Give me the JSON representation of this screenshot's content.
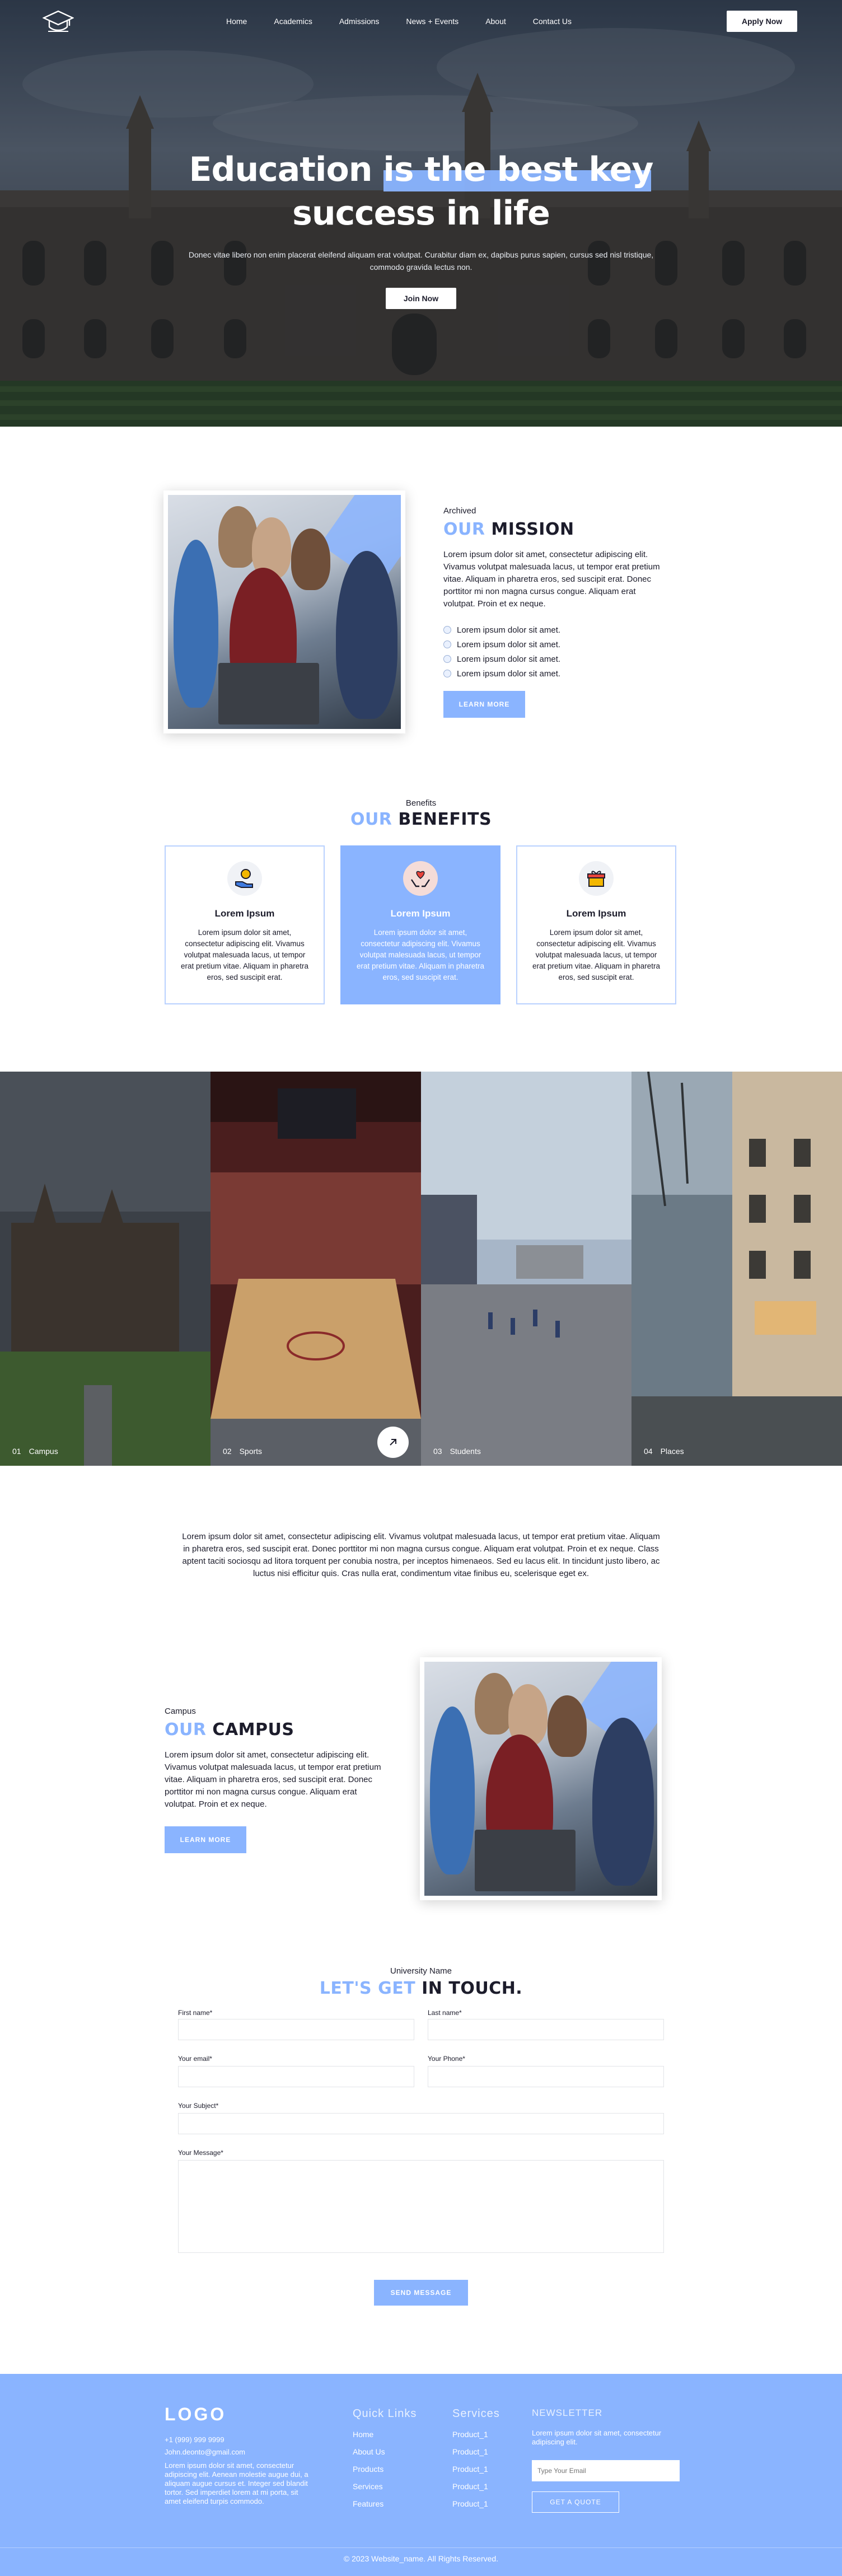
{
  "colors": {
    "accent": "#8ab4ff",
    "text": "#1c1c2b",
    "white": "#ffffff"
  },
  "nav": {
    "logo_icon": "graduation-cap-icon",
    "links": [
      "Home",
      "Academics",
      "Admissions",
      "News + Events",
      "About",
      "Contact Us"
    ],
    "apply_label": "Apply Now"
  },
  "hero": {
    "title_line1": "Education is the best key",
    "title_line2": "success in life",
    "subtitle": "Donec vitae libero non enim placerat eleifend aliquam erat volutpat. Curabitur diam ex, dapibus purus sapien, cursus sed nisl tristique, commodo gravida lectus non.",
    "cta_label": "Join Now"
  },
  "mission": {
    "eyebrow": "Archived",
    "title_accent": "OUR",
    "title_rest": "MISSION",
    "text": "Lorem ipsum dolor sit amet, consectetur adipiscing elit. Vivamus volutpat malesuada lacus, ut tempor erat pretium vitae. Aliquam in pharetra eros, sed suscipit erat. Donec porttitor mi non magna cursus congue. Aliquam erat volutpat. Proin et ex neque.",
    "checklist": [
      "Lorem ipsum dolor sit amet.",
      "Lorem ipsum dolor sit amet.",
      "Lorem ipsum dolor sit amet.",
      "Lorem ipsum dolor sit amet."
    ],
    "button_label": "LEARN MORE"
  },
  "benefits": {
    "eyebrow": "Benefits",
    "title_accent": "OUR",
    "title_rest": "BENEFITS",
    "cards": [
      {
        "icon": "hand-coin-icon",
        "title": "Lorem Ipsum",
        "text": "Lorem ipsum dolor sit amet, consectetur adipiscing elit. Vivamus volutpat malesuada lacus, ut tempor erat pretium vitae. Aliquam in pharetra eros, sed suscipit erat."
      },
      {
        "icon": "heart-hands-icon",
        "title": "Lorem Ipsum",
        "text": "Lorem ipsum dolor sit amet, consectetur adipiscing elit. Vivamus volutpat malesuada lacus, ut tempor erat pretium vitae. Aliquam in pharetra eros, sed suscipit erat."
      },
      {
        "icon": "gift-box-icon",
        "title": "Lorem Ipsum",
        "text": "Lorem ipsum dolor sit amet, consectetur adipiscing elit. Vivamus volutpat malesuada lacus, ut tempor erat pretium vitae. Aliquam in pharetra eros, sed suscipit erat."
      }
    ]
  },
  "gallery": [
    {
      "num": "01",
      "label": "Campus"
    },
    {
      "num": "02",
      "label": "Sports"
    },
    {
      "num": "03",
      "label": "Students"
    },
    {
      "num": "04",
      "label": "Places"
    }
  ],
  "intro_paragraph": "Lorem ipsum dolor sit amet, consectetur adipiscing elit. Vivamus volutpat malesuada lacus, ut tempor erat pretium vitae. Aliquam in pharetra eros, sed suscipit erat. Donec porttitor mi non magna cursus congue. Aliquam erat volutpat. Proin et ex neque. Class aptent taciti sociosqu ad litora torquent per conubia nostra, per inceptos himenaeos. Sed eu lacus elit. In tincidunt justo libero, ac luctus nisi efficitur quis. Cras nulla erat, condimentum vitae finibus eu, scelerisque eget ex.",
  "campus": {
    "eyebrow": "Campus",
    "title_accent": "OUR",
    "title_rest": "CAMPUS",
    "text": "Lorem ipsum dolor sit amet, consectetur adipiscing elit. Vivamus volutpat malesuada lacus, ut tempor erat pretium vitae. Aliquam in pharetra eros, sed suscipit erat. Donec porttitor mi non magna cursus congue. Aliquam erat volutpat. Proin et ex neque.",
    "button_label": "LEARN MORE"
  },
  "contact": {
    "eyebrow": "University Name",
    "title_accent": "LET'S GET",
    "title_rest": "IN TOUCH.",
    "labels": {
      "first_name": "First name*",
      "last_name": "Last name*",
      "email": "Your email*",
      "phone": "Your Phone*",
      "subject": "Your Subject*",
      "message": "Your Message*"
    },
    "submit_label": "SEND MESSAGE"
  },
  "footer": {
    "logo": "LOGO",
    "phone": "+1 (999) 999 9999",
    "email": "John.deonto@gmail.com",
    "about": "Lorem ipsum dolor sit amet, consectetur adipiscing elit. Aenean molestie augue dui, a aliquam augue cursus et. Integer sed blandit tortor. Sed imperdiet lorem at mi porta, sit amet eleifend turpis commodo.",
    "quick_links_title": "Quick Links",
    "quick_links": [
      "Home",
      "About Us",
      "Products",
      "Services",
      "Features"
    ],
    "services_title": "Services",
    "services": [
      "Product_1",
      "Product_1",
      "Product_1",
      "Product_1",
      "Product_1"
    ],
    "newsletter_title": "NEWSLETTER",
    "newsletter_text": "Lorem ipsum dolor sit amet, consectetur adipiscing elit.",
    "email_placeholder": "Type Your Email",
    "quote_label": "GET A QUOTE",
    "copyright": "© 2023 Website_name. All Rights Reserved."
  }
}
